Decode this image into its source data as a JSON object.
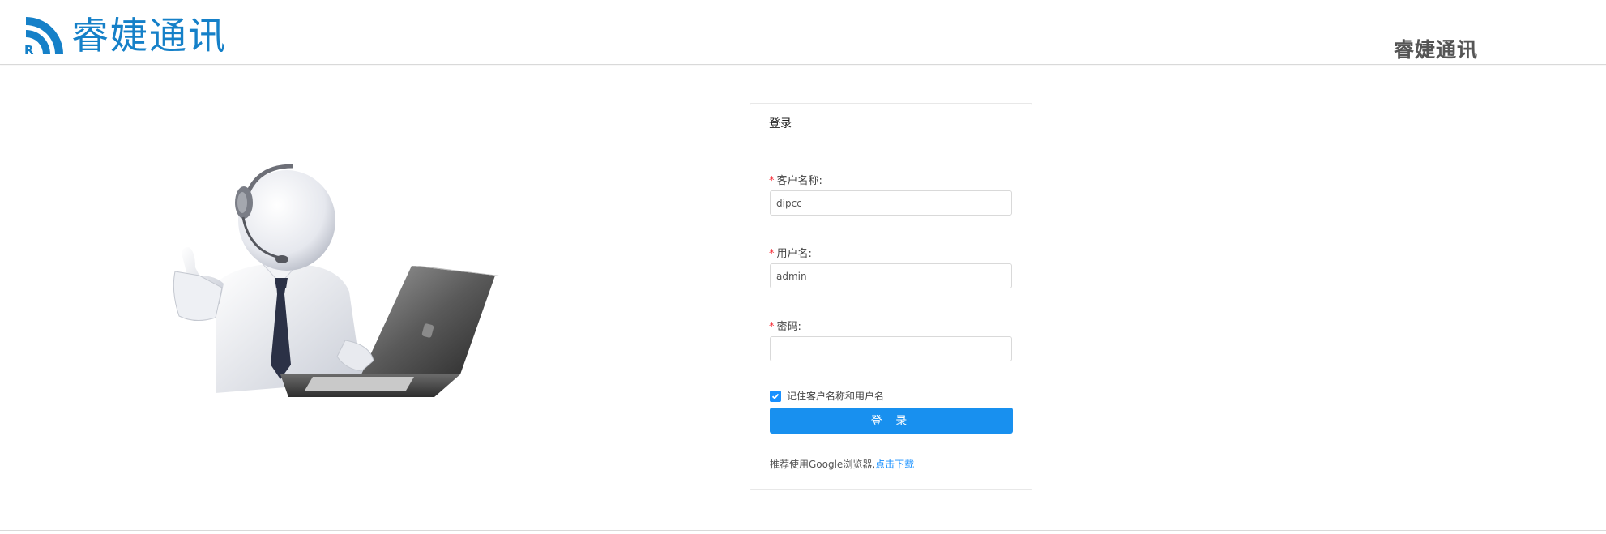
{
  "header": {
    "logo_text": "睿婕通讯",
    "logo_letter": "R",
    "title": "睿婕通讯",
    "brand_color": "#1580c8"
  },
  "login": {
    "card_title": "登录",
    "customer_label": "客户名称:",
    "customer_value": "dipcc",
    "username_label": "用户名:",
    "username_value": "admin",
    "password_label": "密码:",
    "password_value": "",
    "required_mark": "*",
    "remember_label": "记住客户名称和用户名",
    "remember_checked": true,
    "submit_label": "登 录",
    "recommend_text": "推荐使用Google浏览器,",
    "download_link": "点击下载",
    "accent_color": "#1890ff"
  },
  "illustration": {
    "icon": "support-agent-with-laptop-illustration"
  }
}
